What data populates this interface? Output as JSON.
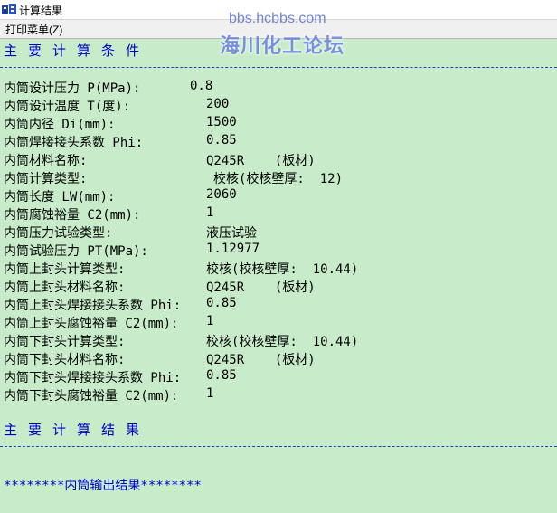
{
  "window": {
    "title": "计算结果"
  },
  "menu": {
    "print": "打印菜单(Z)"
  },
  "watermark": {
    "url": "bbs.hcbbs.com",
    "name": "海川化工论坛"
  },
  "conditions": {
    "title": "主要计算条件",
    "rows": [
      {
        "label": "内筒设计压力 P(MPa):",
        "value": "0.8"
      },
      {
        "label": "内筒设计温度 T(度):",
        "value": "200"
      },
      {
        "label": "内筒内径 Di(mm):",
        "value": "1500"
      },
      {
        "label": "内筒焊接接头系数 Phi:",
        "value": "0.85"
      },
      {
        "label": "内筒材料名称:",
        "value": "Q245R    (板材)"
      },
      {
        "label": "内筒计算类型:",
        "value": "校核(校核壁厚:  12)"
      },
      {
        "label": "内筒长度 LW(mm):",
        "value": "2060"
      },
      {
        "label": "内筒腐蚀裕量 C2(mm):",
        "value": "1"
      },
      {
        "label": "内筒压力试验类型:",
        "value": "液压试验"
      },
      {
        "label": "内筒试验压力 PT(MPa):",
        "value": "1.12977"
      },
      {
        "label": "内筒上封头计算类型:",
        "value": "校核(校核壁厚:  10.44)"
      },
      {
        "label": "内筒上封头材料名称:",
        "value": "Q245R    (板材)"
      },
      {
        "label": "内筒上封头焊接接头系数 Phi:",
        "value": "0.85"
      },
      {
        "label": "内筒上封头腐蚀裕量 C2(mm):",
        "value": "1"
      },
      {
        "label": "内筒下封头计算类型:",
        "value": "校核(校核壁厚:  10.44)"
      },
      {
        "label": "内筒下封头材料名称:",
        "value": "Q245R    (板材)"
      },
      {
        "label": "内筒下封头焊接接头系数 Phi:",
        "value": "0.85"
      },
      {
        "label": "内筒下封头腐蚀裕量 C2(mm):",
        "value": "1"
      }
    ]
  },
  "results": {
    "title": "主要计算结果",
    "output_label": "********内筒输出结果********"
  },
  "colors": {
    "background": "#c8ecca",
    "heading": "#0000c8",
    "separator": "#2040c8"
  }
}
